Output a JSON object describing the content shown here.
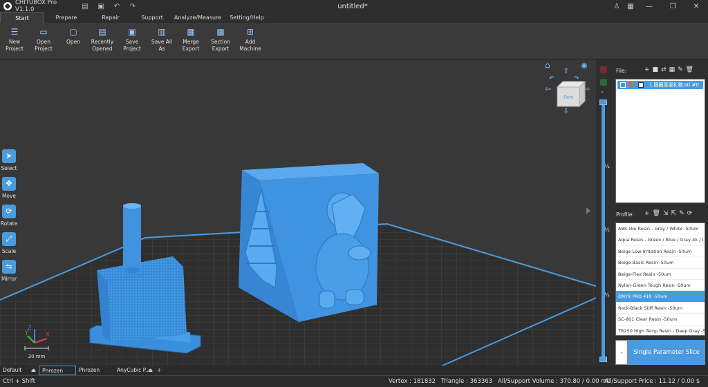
{
  "app": {
    "title": "CHITUBOX Pro V1.1.0",
    "document_title": "untitled*"
  },
  "menu_tabs": [
    "Start",
    "Prepare",
    "Repair",
    "Support",
    "Analyze/Measure",
    "Setting/Help"
  ],
  "ribbon": [
    {
      "label": "New Project",
      "icon": "new-project-icon"
    },
    {
      "label": "Open Project",
      "icon": "open-project-icon"
    },
    {
      "label": "Open",
      "icon": "open-icon"
    },
    {
      "label": "Recently Opened",
      "icon": "recent-icon"
    },
    {
      "label": "Save Project",
      "icon": "save-icon"
    },
    {
      "label": "Save All As",
      "icon": "save-all-icon"
    },
    {
      "label": "Merge Export",
      "icon": "merge-icon"
    },
    {
      "label": "Section Export",
      "icon": "section-icon"
    },
    {
      "label": "Add Machine",
      "icon": "add-machine-icon"
    }
  ],
  "tools": [
    "Select",
    "Move",
    "Rotate",
    "Scale",
    "Mirror"
  ],
  "view_cube_label": "Fort",
  "scale_bar": "20 mm",
  "slider_marks": [
    "¼",
    "½",
    "¼"
  ],
  "file_panel": {
    "label": "File:",
    "item": "1.圆圈圣诞礼物.stl #0"
  },
  "profile_panel": {
    "label": "Profile:",
    "items": [
      "ABS-like Resin - Gray / White -50um",
      "Aqua Resin - Green / Blue / Gray-4k / I",
      "Beige Low-Irritation Resin -50um",
      "Beige-Basic Resin -50um",
      "Beige-Flex Resin -50um",
      "Nylon-Green Tough Resin -50um",
      "ONYX PRO 410 -50um",
      "Rock-Black Stiff Resin -50um",
      "SC-801 Clear Resin -50um",
      "TR250 High Temp Resin - Deep Gray -5"
    ],
    "selected_index": 6
  },
  "slice_button": {
    "minus": "-",
    "label": "Single Parameter Slice"
  },
  "plate_tabs": [
    "Default",
    "Phrozen So...",
    "Phrozen So...",
    "AnyCubic P..."
  ],
  "plate_add": "+",
  "status": {
    "shortcut": "Ctrl + Shift",
    "vertex": "Vertex : 181832",
    "triangle": "Triangle : 363363",
    "volume": "All/Support Volume : 370.80 / 0.00 mL",
    "price": "All/Support Price : 11.12 / 0.00 $"
  },
  "colors": {
    "accent": "#4a9bde",
    "model": "#3f93e0",
    "background": "#383838"
  }
}
